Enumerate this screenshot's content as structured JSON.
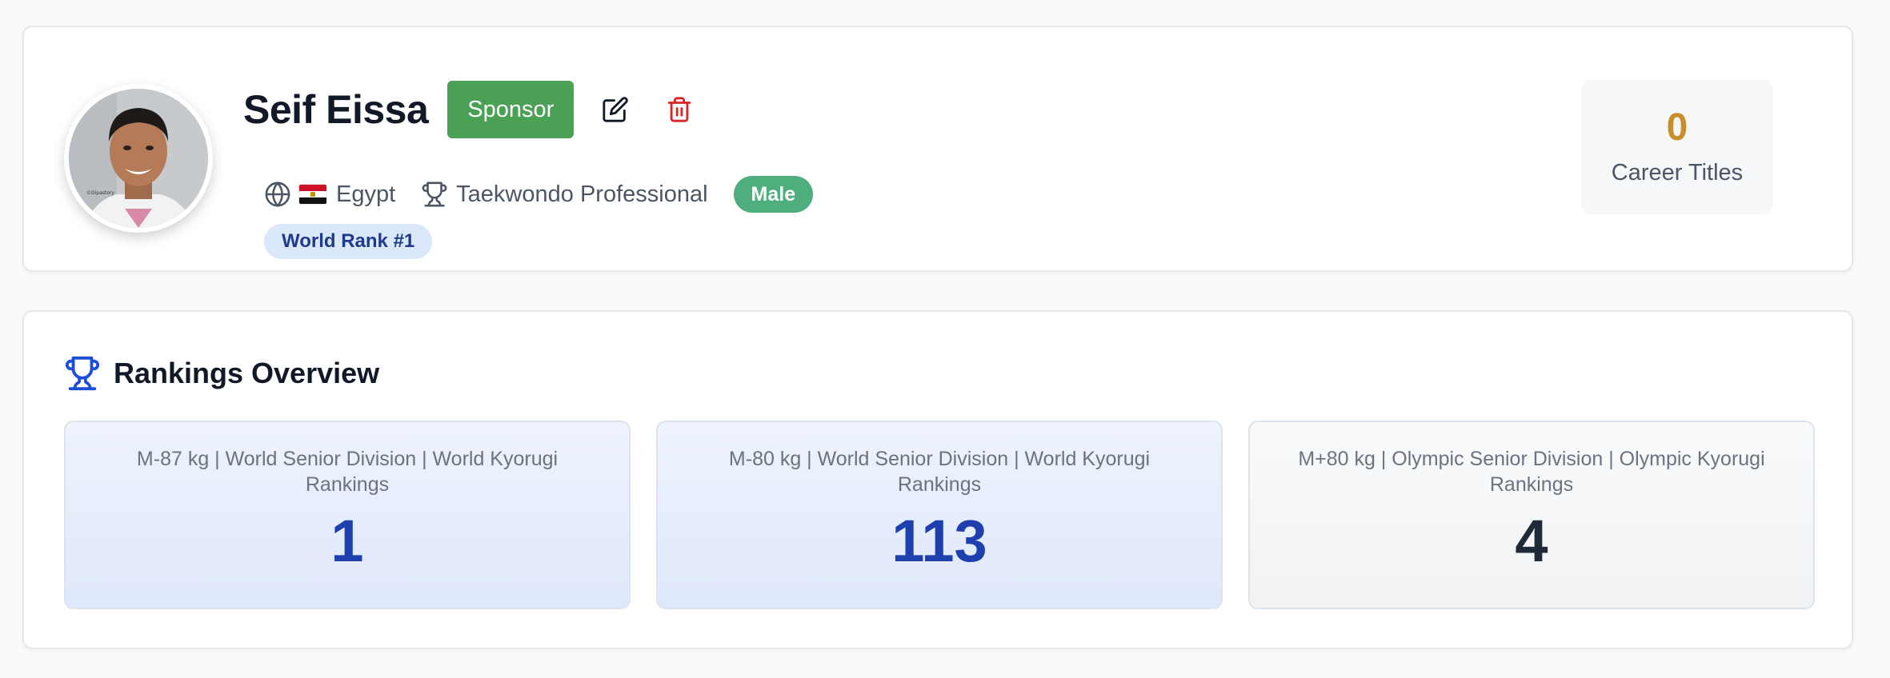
{
  "profile": {
    "name": "Seif Eissa",
    "sponsor_label": "Sponsor",
    "country": "Egypt",
    "sport": "Taekwondo Professional",
    "gender": "Male",
    "world_rank": "World Rank #1",
    "avatar_watermark": "©Dipastory"
  },
  "career_titles": {
    "value": "0",
    "label": "Career Titles"
  },
  "rankings": {
    "title": "Rankings Overview",
    "items": [
      {
        "category": "M-87 kg | World Senior Division | World Kyorugi Rankings",
        "rank": "1",
        "style": "blue"
      },
      {
        "category": "M-80 kg | World Senior Division | World Kyorugi Rankings",
        "rank": "113",
        "style": "blue"
      },
      {
        "category": "M+80 kg | Olympic Senior Division | Olympic Kyorugi Rankings",
        "rank": "4",
        "style": "gray"
      }
    ]
  },
  "icons": {
    "edit": "edit-icon",
    "delete": "trash-icon",
    "country": "globe-icon",
    "flag": "egypt-flag-icon",
    "sport": "trophy-icon",
    "rankings": "trophy-icon"
  },
  "colors": {
    "sponsor": "#4aa155",
    "gender_badge": "#4fae7e",
    "rank_badge_bg": "#dbe7fb",
    "rank_badge_text": "#1e3a8a",
    "titles_value": "#c98d2a",
    "rank_blue": "#1e40af",
    "delete": "#dc2626",
    "rankings_icon": "#1d4ed8"
  }
}
